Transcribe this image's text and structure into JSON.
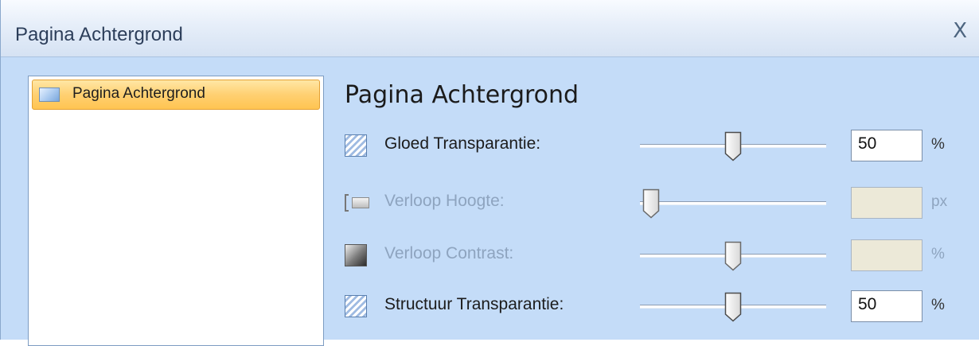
{
  "window": {
    "title": "Pagina Achtergrond",
    "close_symbol": "X"
  },
  "nav": {
    "items": [
      {
        "label": "Pagina Achtergrond",
        "selected": true
      }
    ]
  },
  "section": {
    "title": "Pagina Achtergrond"
  },
  "settings": [
    {
      "label": "Gloed Transparantie:",
      "icon": "pattern-icon",
      "value": "50",
      "unit": "%",
      "slider_fraction": 0.5,
      "enabled": true
    },
    {
      "label": "Verloop Hoogte:",
      "icon": "gradient-height-icon",
      "value": "",
      "unit": "px",
      "slider_fraction": 0.0,
      "enabled": false
    },
    {
      "label": "Verloop Contrast:",
      "icon": "contrast-icon",
      "value": "",
      "unit": "%",
      "slider_fraction": 0.5,
      "enabled": false
    },
    {
      "label": "Structuur Transparantie:",
      "icon": "texture-icon",
      "value": "50",
      "unit": "%",
      "slider_fraction": 0.5,
      "enabled": true
    }
  ],
  "colors": {
    "panel_bg": "#c4dcf8",
    "selected_item": "#ffd072",
    "disabled_text": "#8ea4bf"
  }
}
